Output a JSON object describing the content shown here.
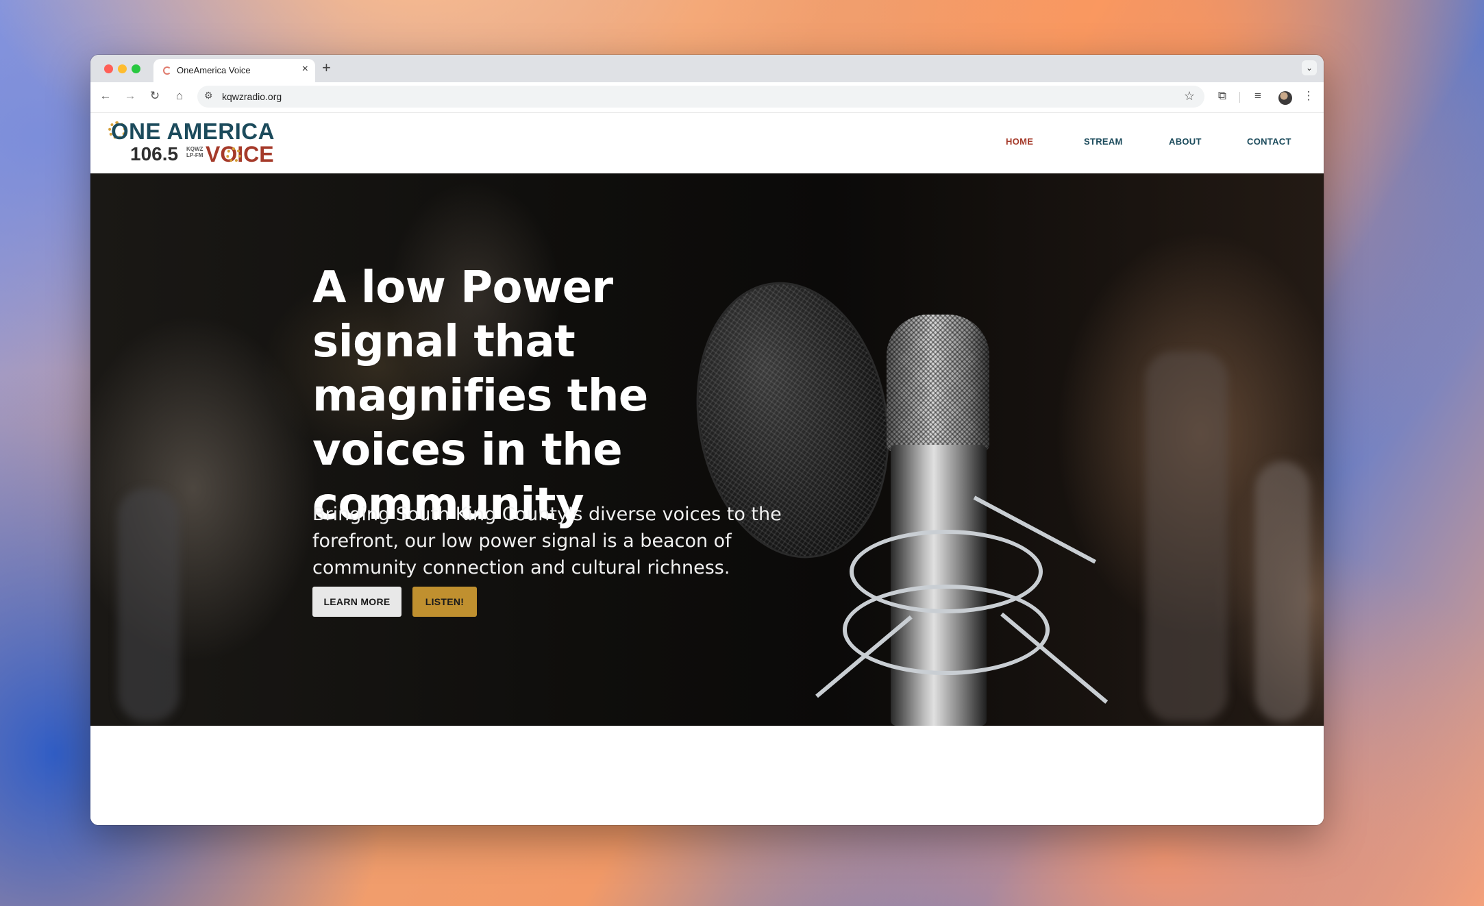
{
  "browser": {
    "tab_title": "OneAmerica Voice",
    "tab_close": "×",
    "new_tab": "+",
    "tab_menu": "⌄",
    "url": "kqwzradio.org",
    "icons": [
      "back-icon",
      "forward-icon",
      "reload-icon",
      "home-icon",
      "site-settings-icon",
      "bookmark-star-icon",
      "extensions-icon",
      "reading-list-icon",
      "profile-avatar",
      "more-menu-icon"
    ],
    "glyphs": {
      "back": "←",
      "forward": "→",
      "reload": "↻",
      "home": "⌂",
      "site": "⚙",
      "star": "☆",
      "extensions": "⧉",
      "media": "≡",
      "more": "⋮"
    }
  },
  "site": {
    "logo": {
      "line1": "ONE AMERICA",
      "frequency": "106.5",
      "callsign": "KQWZ",
      "band": "LP-FM",
      "line2": "VOICE"
    },
    "nav": [
      {
        "label": "HOME",
        "active": true
      },
      {
        "label": "STREAM",
        "active": false
      },
      {
        "label": "ABOUT",
        "active": false
      },
      {
        "label": "CONTACT",
        "active": false
      }
    ],
    "colors": {
      "brand_teal": "#1c4b5c",
      "brand_red": "#a53a2a",
      "brand_gold": "#c0902f"
    }
  },
  "hero": {
    "title": "A low Power signal that magnifies the voices in the community",
    "subtitle": "Bringing South King County's diverse voices to the forefront, our low power signal is a beacon of community connection and cultural richness.",
    "buttons": {
      "learn_more": "LEARN MORE",
      "listen": "LISTEN!"
    }
  }
}
